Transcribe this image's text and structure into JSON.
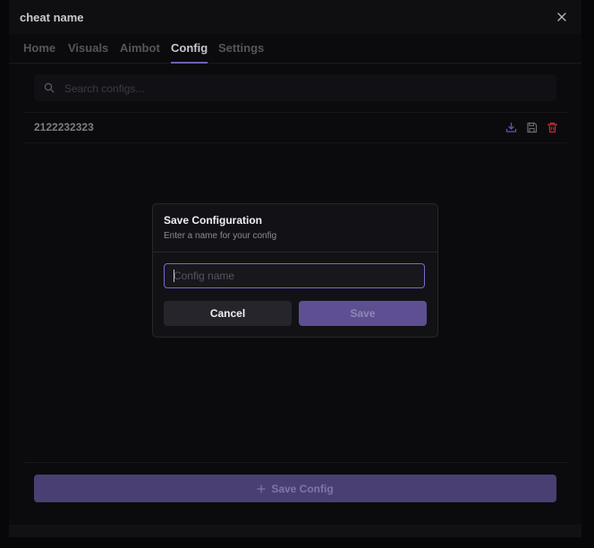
{
  "window": {
    "title": "cheat name",
    "close_icon": "close-icon"
  },
  "tabs": [
    {
      "label": "Home",
      "active": false
    },
    {
      "label": "Visuals",
      "active": false
    },
    {
      "label": "Aimbot",
      "active": false
    },
    {
      "label": "Config",
      "active": true
    },
    {
      "label": "Settings",
      "active": false
    }
  ],
  "search": {
    "placeholder": "Search configs...",
    "value": "",
    "icon": "search-icon"
  },
  "configs": [
    {
      "name": "2122232323",
      "actions": [
        "download-icon",
        "save-icon",
        "trash-icon"
      ]
    }
  ],
  "footer": {
    "save_config_label": "Save Config",
    "icon": "plus-icon"
  },
  "dialog": {
    "title": "Save Configuration",
    "subtitle": "Enter a name for your config",
    "input_placeholder": "Config name",
    "input_value": "",
    "cancel_label": "Cancel",
    "save_label": "Save"
  },
  "colors": {
    "accent": "#6f5fb3",
    "background": "#0b0b0e",
    "danger": "#c0302f"
  }
}
